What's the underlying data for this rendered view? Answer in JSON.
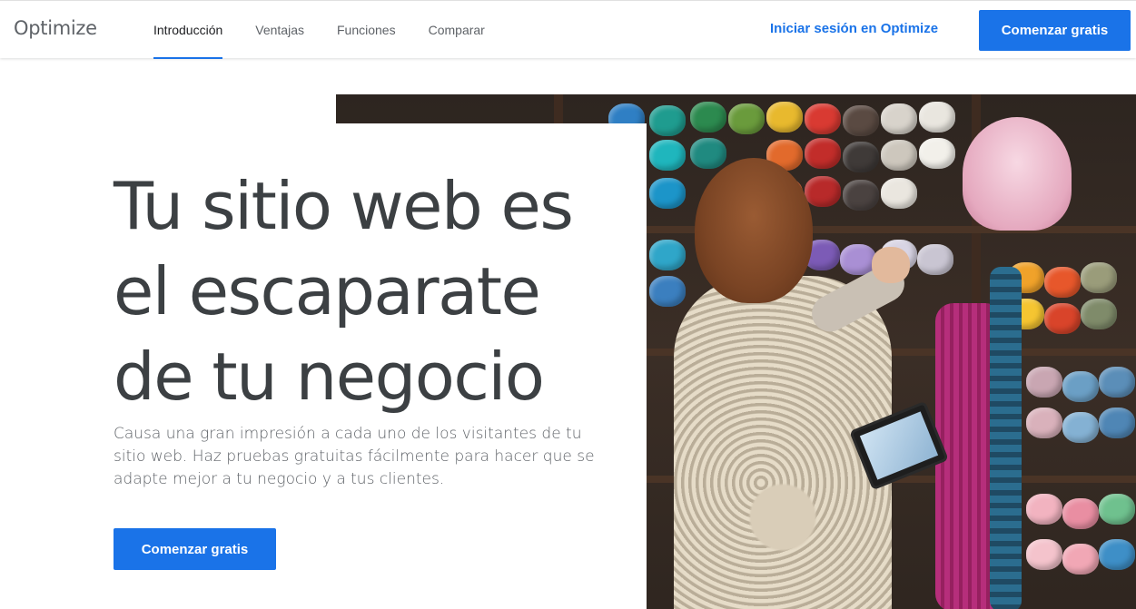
{
  "header": {
    "logo": "Optimize",
    "nav": [
      {
        "label": "Introducción",
        "active": true
      },
      {
        "label": "Ventajas",
        "active": false
      },
      {
        "label": "Funciones",
        "active": false
      },
      {
        "label": "Comparar",
        "active": false
      }
    ],
    "signin_label": "Iniciar sesión en Optimize",
    "cta_label": "Comenzar gratis"
  },
  "hero": {
    "title_lines": [
      "Tu sitio web es",
      "el escaparate",
      "de tu negocio"
    ],
    "description": "Causa una gran impresión a cada uno de los visitantes de tu sitio web. Haz pruebas gratuitas fácilmente para hacer que se adapte mejor a tu negocio y a tus clientes.",
    "cta_label": "Comenzar gratis",
    "image": "photo-woman-browsing-yarn-shop-with-tablet"
  },
  "colors": {
    "accent": "#1a73e8",
    "title_text": "#3c4043",
    "body_text": "#5f6368"
  }
}
